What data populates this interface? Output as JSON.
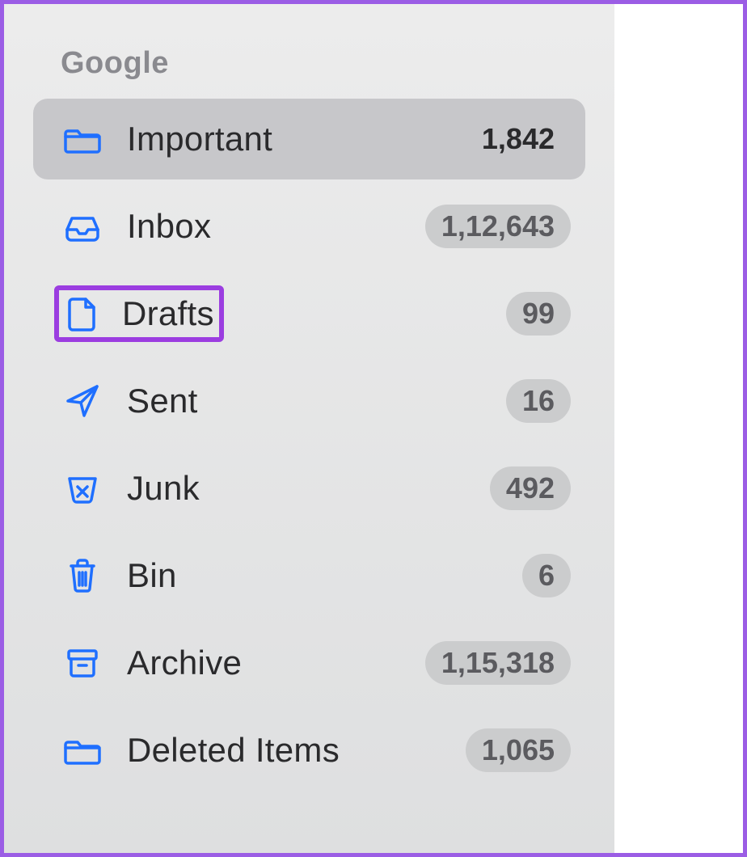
{
  "colors": {
    "accent": "#1f6fff",
    "highlight_border": "#9b3de0",
    "frame_border": "#9b5de5"
  },
  "sidebar": {
    "section_title": "Google",
    "items": [
      {
        "icon": "folder-icon",
        "label": "Important",
        "count": "1,842",
        "selected": true,
        "highlighted": false
      },
      {
        "icon": "inbox-icon",
        "label": "Inbox",
        "count": "1,12,643",
        "selected": false,
        "highlighted": false
      },
      {
        "icon": "document-icon",
        "label": "Drafts",
        "count": "99",
        "selected": false,
        "highlighted": true
      },
      {
        "icon": "send-icon",
        "label": "Sent",
        "count": "16",
        "selected": false,
        "highlighted": false
      },
      {
        "icon": "junk-icon",
        "label": "Junk",
        "count": "492",
        "selected": false,
        "highlighted": false
      },
      {
        "icon": "trash-icon",
        "label": "Bin",
        "count": "6",
        "selected": false,
        "highlighted": false
      },
      {
        "icon": "archive-icon",
        "label": "Archive",
        "count": "1,15,318",
        "selected": false,
        "highlighted": false
      },
      {
        "icon": "folder-icon",
        "label": "Deleted Items",
        "count": "1,065",
        "selected": false,
        "highlighted": false
      }
    ]
  }
}
